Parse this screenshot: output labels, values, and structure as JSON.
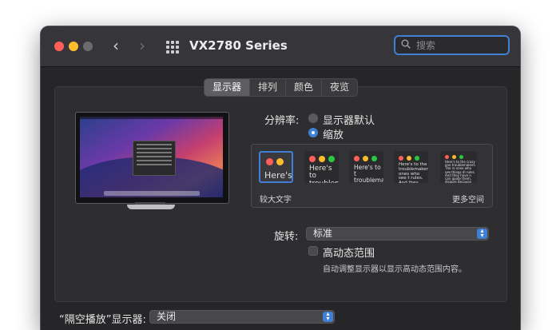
{
  "window": {
    "title": "VX2780 Series",
    "search_placeholder": "搜索",
    "nav_back": "‹",
    "nav_forward": "›"
  },
  "tabs": [
    {
      "label": "显示器",
      "active": true
    },
    {
      "label": "排列",
      "active": false
    },
    {
      "label": "颜色",
      "active": false
    },
    {
      "label": "夜览",
      "active": false
    }
  ],
  "resolution": {
    "label": "分辨率:",
    "options": [
      {
        "label": "显示器默认",
        "selected": false
      },
      {
        "label": "缩放",
        "selected": true
      }
    ]
  },
  "scaling": {
    "thumbs": [
      {
        "text": "Here's",
        "selected": true
      },
      {
        "text": "Here's to troubleme",
        "selected": false
      },
      {
        "text": "Here's to t troublema ones who s",
        "selected": false
      },
      {
        "text": "Here's to the troublemakers, ones who see t rules. And they",
        "selected": false
      },
      {
        "text": "Here's to the crazy one troublemakers. The ro ones who see things di rules. And they have n can quote them, disagre Because they change t",
        "selected": false
      }
    ],
    "left_label": "较大文字",
    "right_label": "更多空间"
  },
  "rotation": {
    "label": "旋转:",
    "value": "标准"
  },
  "hdr": {
    "label": "高动态范围",
    "checked": false,
    "hint": "自动调整显示器以显示高动态范围内容。"
  },
  "airplay": {
    "label": "“隔空播放”显示器:",
    "value": "关闭"
  },
  "colors": {
    "accent": "#3f7fd4",
    "close": "#ff5f57",
    "minimize": "#febc2e",
    "zoom": "#6c6c70"
  }
}
